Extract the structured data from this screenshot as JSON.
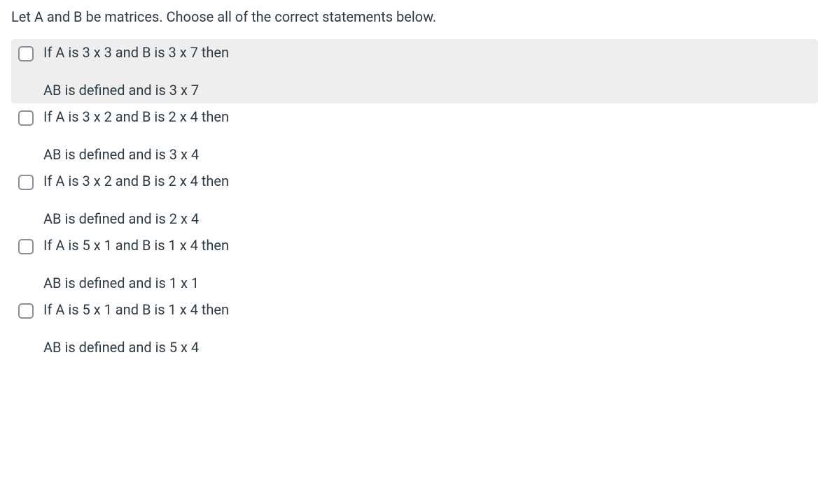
{
  "question": {
    "prompt": "Let A and B be matrices. Choose all of the correct statements below.",
    "options": [
      {
        "line1": "If A is 3 x 3 and B is 3 x 7 then",
        "line2": "AB is defined and is 3 x 7",
        "highlighted": true,
        "checked": false
      },
      {
        "line1": "If A is 3 x 2 and B is 2 x 4 then",
        "line2": "AB is defined and is 3 x 4",
        "highlighted": false,
        "checked": false
      },
      {
        "line1": "If A is 3 x 2 and B is 2 x 4 then",
        "line2": "AB is defined and is 2 x 4",
        "highlighted": false,
        "checked": false
      },
      {
        "line1": "If A is 5 x 1 and B is 1 x 4 then",
        "line2": "AB is defined and is 1 x 1",
        "highlighted": false,
        "checked": false
      },
      {
        "line1": "If A is 5 x 1 and B is 1 x 4 then",
        "line2": "AB is defined and is 5 x 4",
        "highlighted": false,
        "checked": false
      }
    ]
  }
}
